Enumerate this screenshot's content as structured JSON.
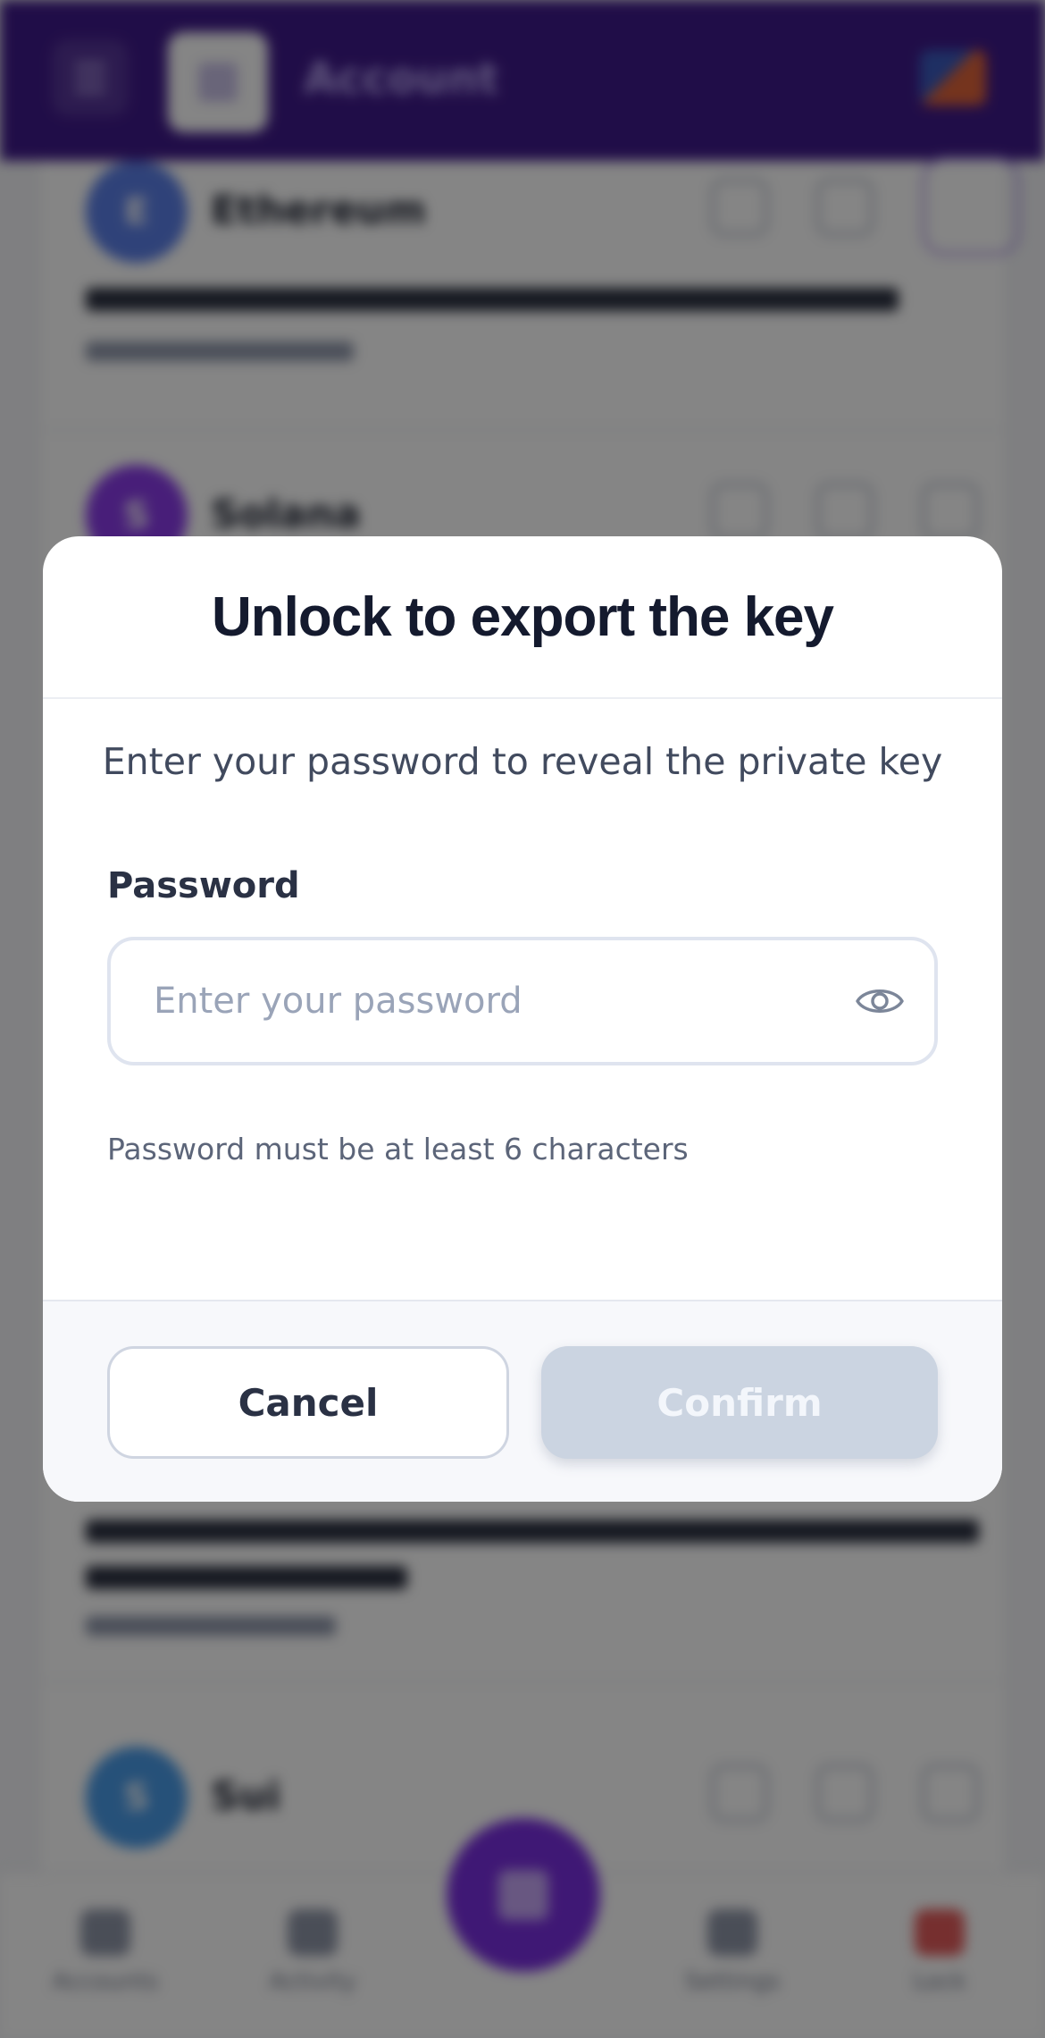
{
  "background": {
    "header": {
      "title": "Account"
    },
    "tokens": [
      {
        "name": "Ethereum",
        "letter": "E",
        "color": "#5b7fe8"
      },
      {
        "name": "Solana",
        "letter": "S",
        "color": "#8a3be8"
      },
      {
        "name": "Sui",
        "letter": "S",
        "color": "#4a9be8"
      }
    ],
    "nav": {
      "items": [
        "Accounts",
        "Activity",
        "Apps",
        "Settings",
        "Lock"
      ]
    }
  },
  "modal": {
    "title": "Unlock to export the key",
    "description": "Enter your password to reveal the private key",
    "password_label": "Password",
    "password_placeholder": "Enter your password",
    "password_value": "",
    "hint": "Password must be at least 6 characters",
    "cancel_label": "Cancel",
    "confirm_label": "Confirm",
    "confirm_enabled": false
  },
  "icons": {
    "reveal": "eye-icon"
  },
  "colors": {
    "header_bg": "#3f1a8a",
    "confirm_disabled_bg": "#cbd4e1",
    "title_text": "#141a2e"
  }
}
